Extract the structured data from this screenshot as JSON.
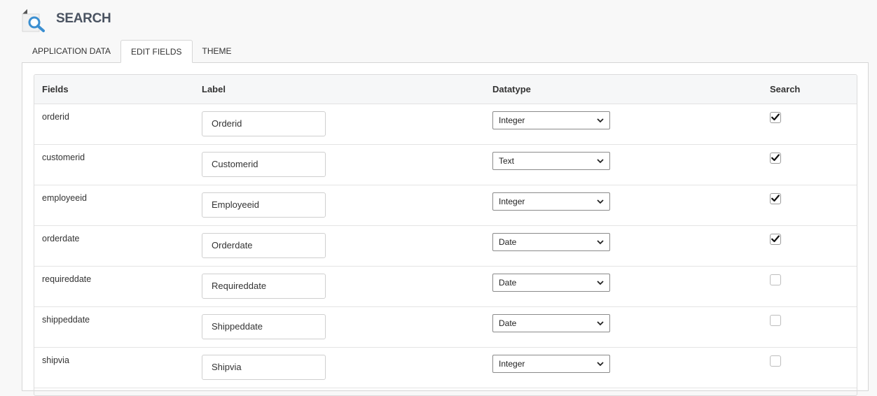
{
  "page": {
    "title": "SEARCH"
  },
  "tabs": [
    {
      "label": "APPLICATION DATA",
      "active": false
    },
    {
      "label": "EDIT FIELDS",
      "active": true
    },
    {
      "label": "THEME",
      "active": false
    }
  ],
  "table": {
    "headers": {
      "fields": "Fields",
      "label": "Label",
      "datatype": "Datatype",
      "search": "Search"
    },
    "rows": [
      {
        "field": "orderid",
        "label": "Orderid",
        "datatype": "Integer",
        "search": true
      },
      {
        "field": "customerid",
        "label": "Customerid",
        "datatype": "Text",
        "search": true
      },
      {
        "field": "employeeid",
        "label": "Employeeid",
        "datatype": "Integer",
        "search": true
      },
      {
        "field": "orderdate",
        "label": "Orderdate",
        "datatype": "Date",
        "search": true
      },
      {
        "field": "requireddate",
        "label": "Requireddate",
        "datatype": "Date",
        "search": false
      },
      {
        "field": "shippeddate",
        "label": "Shippeddate",
        "datatype": "Date",
        "search": false
      },
      {
        "field": "shipvia",
        "label": "Shipvia",
        "datatype": "Integer",
        "search": false
      }
    ]
  },
  "colors": {
    "title": "#4a5361",
    "icon_blue": "#3b8fd1",
    "border": "#d6d6d6"
  },
  "icons": {
    "page": "search-document-icon",
    "select": "chevron-down-icon",
    "check": "check-icon"
  }
}
